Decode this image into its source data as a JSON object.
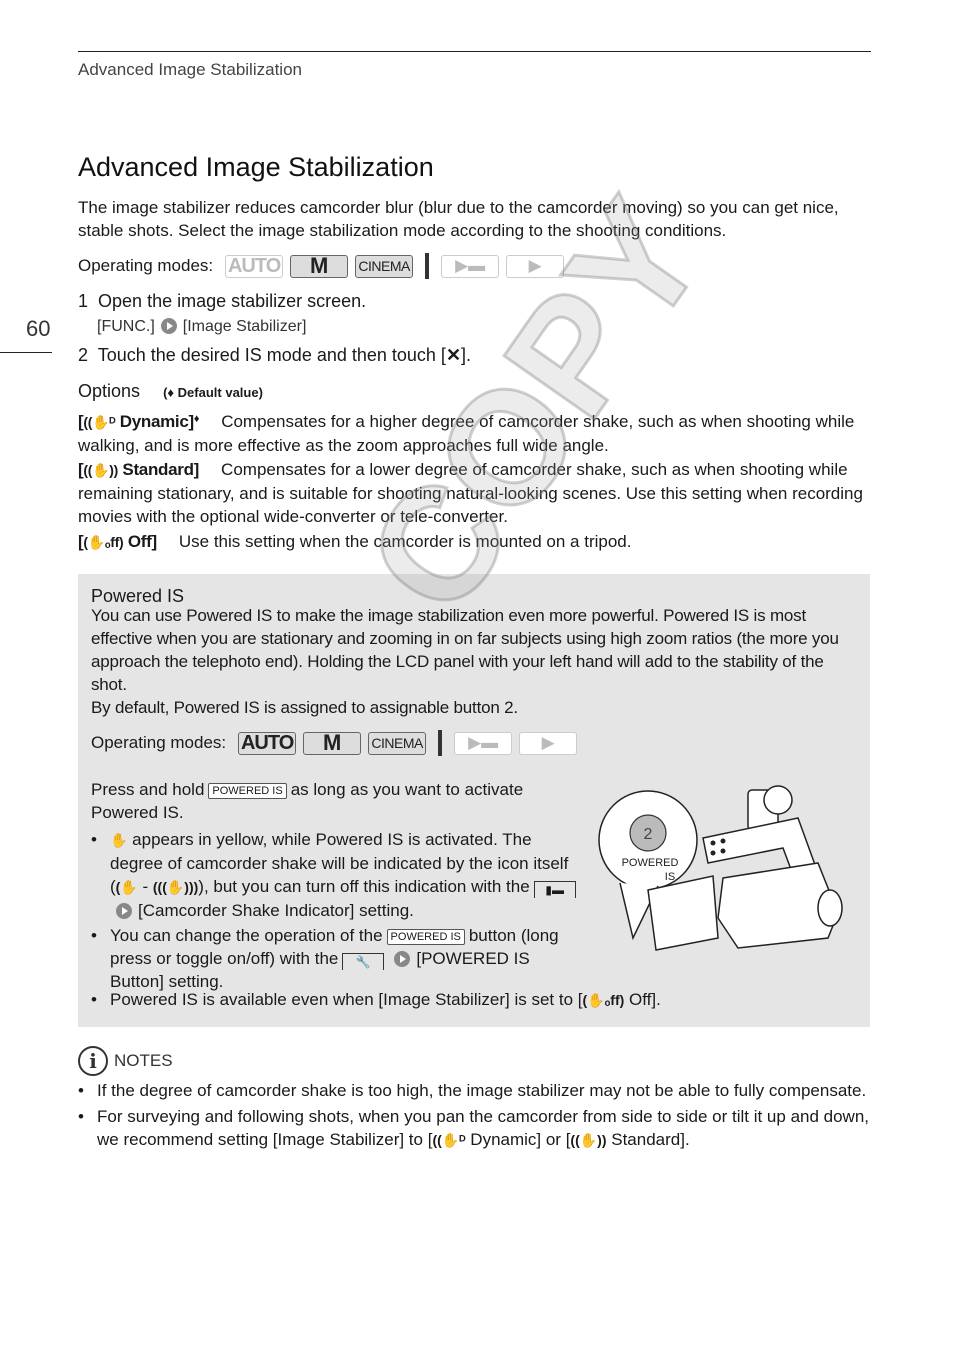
{
  "header": {
    "running_title": "Advanced Image Stabilization",
    "page_number": "60"
  },
  "title": "Advanced Image Stabilization",
  "intro": "The image stabilizer reduces camcorder blur (blur due to the camcorder moving) so you can get nice, stable shots. Select the image stabilization mode according to the shooting conditions.",
  "operating_modes": {
    "label": "Operating modes:",
    "modes": [
      {
        "name": "AUTO",
        "enabled": false
      },
      {
        "name": "M",
        "enabled": true
      },
      {
        "name": "CINEMA",
        "enabled": true
      },
      {
        "name": "playback-movies",
        "enabled": false
      },
      {
        "name": "playback-photos",
        "enabled": false
      }
    ]
  },
  "steps": [
    {
      "num": "1",
      "text": "Open the image stabilizer screen.",
      "sub_prefix": "[FUNC.]",
      "sub_suffix": "[Image Stabilizer]"
    },
    {
      "num": "2",
      "text": "Touch the desired IS mode and then touch [",
      "text_end": "]."
    }
  ],
  "options": {
    "heading": "Options",
    "default_note": "Default value)",
    "items": [
      {
        "label": "Dynamic]",
        "icon": "is-dynamic-icon",
        "default": true,
        "text": "Compensates for a higher degree of camcorder shake, such as when shooting while walking, and is more effective as the zoom approaches full wide angle."
      },
      {
        "label": "Standard]",
        "icon": "is-standard-icon",
        "default": false,
        "text": "Compensates for a lower degree of camcorder shake, such as when shooting while remaining stationary, and is suitable for shooting natural-looking scenes. Use this setting when recording movies with the optional wide-converter or tele-converter."
      },
      {
        "label": "Off]",
        "icon": "is-off-icon",
        "default": false,
        "text": "Use this setting when the camcorder is mounted on a tripod."
      }
    ]
  },
  "powered_is": {
    "title": "Powered IS",
    "body1": "You can use Powered IS to make the image stabilization even more powerful. Powered IS is most effective when you are stationary and zooming in on far subjects using high zoom ratios (the more you approach the telephoto end). Holding the LCD panel with your left hand will add to the stability of the shot.",
    "body2": "By default, Powered IS is assigned to assignable button 2.",
    "modes_label": "Operating modes:",
    "modes": [
      {
        "name": "AUTO",
        "enabled": true
      },
      {
        "name": "M",
        "enabled": true
      },
      {
        "name": "CINEMA",
        "enabled": true
      },
      {
        "name": "playback-movies",
        "enabled": false
      },
      {
        "name": "playback-photos",
        "enabled": false
      }
    ],
    "press_prefix": "Press and hold",
    "button_tag": "POWERED IS",
    "press_suffix": "as long as you want to activate Powered IS.",
    "bullet1_a": "appears in yellow, while Powered  IS is activated. The degree of camcorder shake will be indicated by the icon itself (",
    "bullet1_dash": " - ",
    "bullet1_b": "), but you can turn off this indication with the",
    "bullet1_c": "[Camcorder Shake Indicator] setting.",
    "bullet2_a": "You can change the operation of the",
    "bullet2_b": "button (long press or toggle on/off) with the",
    "bullet2_c": "[POWERED IS Button] setting.",
    "bullet3_a": "Powered IS is available even when [Image Stabilizer] is set to [",
    "bullet3_b": " Off].",
    "illustration": {
      "button_number": "2",
      "button_label_1": "POWERED",
      "button_label_2": "IS"
    }
  },
  "notes": {
    "heading": "NOTES",
    "items": [
      "If the degree of camcorder shake is too high, the image stabilizer may not be able to fully compensate.",
      {
        "a": "For surveying and following shots, when you pan the camcorder from side to side or tilt it up and down, we recommend setting [Image Stabilizer] to [",
        "b": " Dynamic] or [",
        "c": " Standard]."
      }
    ]
  },
  "watermark": "COPY"
}
